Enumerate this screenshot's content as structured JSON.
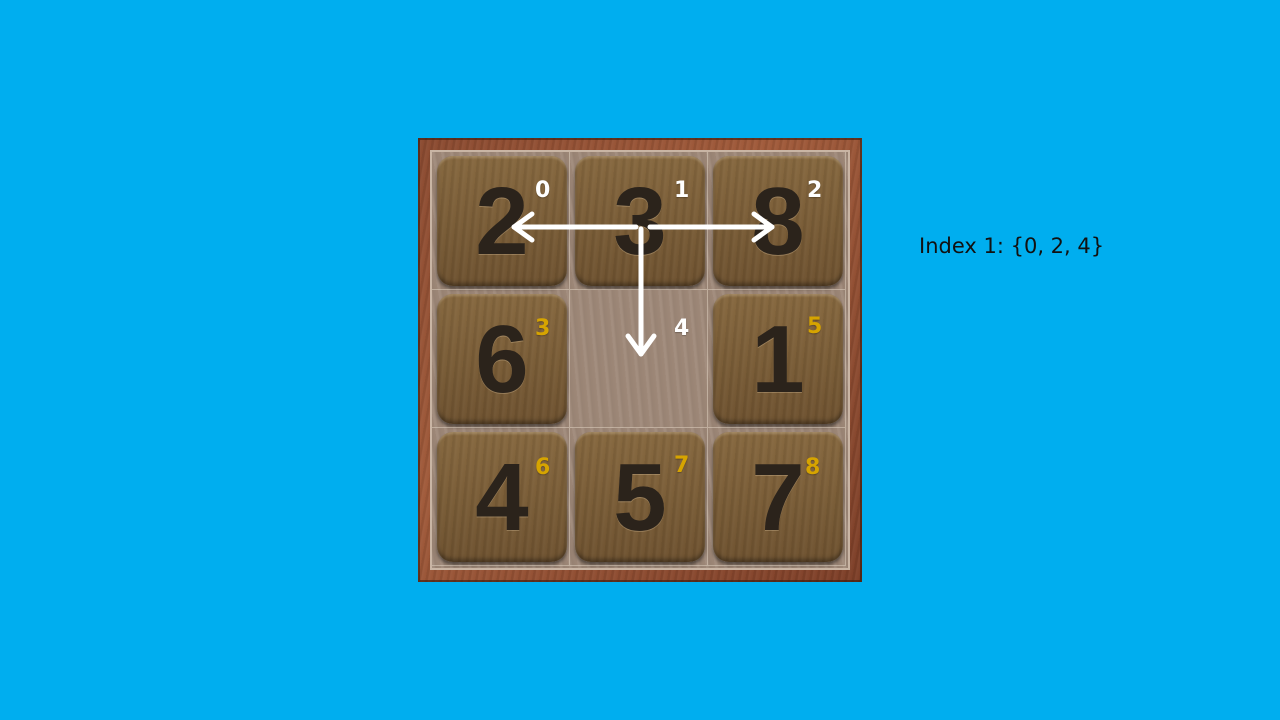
{
  "puzzle": {
    "tiles": [
      {
        "index": "0",
        "number": "2",
        "empty": false,
        "index_style": "white"
      },
      {
        "index": "1",
        "number": "3",
        "empty": false,
        "index_style": "white"
      },
      {
        "index": "2",
        "number": "8",
        "empty": false,
        "index_style": "white"
      },
      {
        "index": "3",
        "number": "6",
        "empty": false,
        "index_style": "gold"
      },
      {
        "index": "4",
        "number": "",
        "empty": true,
        "index_style": "white"
      },
      {
        "index": "5",
        "number": "1",
        "empty": false,
        "index_style": "gold"
      },
      {
        "index": "6",
        "number": "4",
        "empty": false,
        "index_style": "gold"
      },
      {
        "index": "7",
        "number": "5",
        "empty": false,
        "index_style": "gold"
      },
      {
        "index": "8",
        "number": "7",
        "empty": false,
        "index_style": "gold"
      }
    ],
    "selected_index": 1,
    "neighbor_indices": [
      0,
      2,
      4
    ]
  },
  "info": {
    "text": "Index 1: {0, 2, 4}"
  },
  "colors": {
    "background": "#00AEEF",
    "arrow": "#ffffff",
    "index_highlight": "#ffffff",
    "index_default": "#d6a400"
  }
}
